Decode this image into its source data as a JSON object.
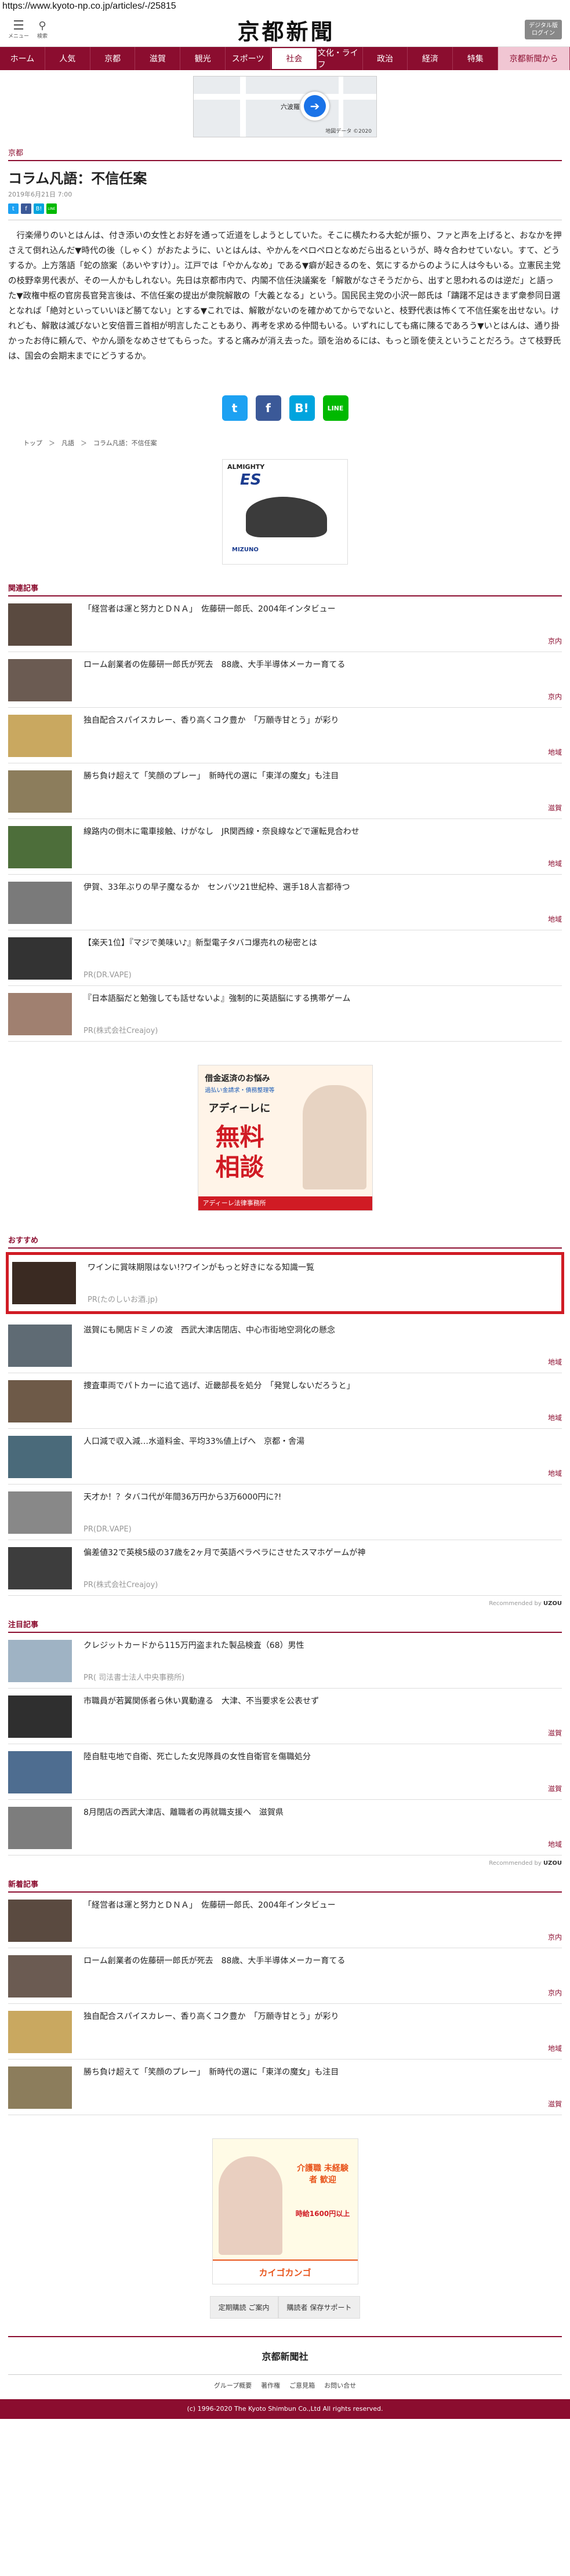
{
  "url": "https://www.kyoto-np.co.jp/articles/-/25815",
  "header": {
    "menu_label": "メニュー",
    "search_label": "検索",
    "logo": "京都新聞",
    "account_label": "デジタル版",
    "account_sub": "ログイン"
  },
  "nav": [
    {
      "label": "ホーム"
    },
    {
      "label": "人気"
    },
    {
      "label": "京都"
    },
    {
      "label": "滋賀"
    },
    {
      "label": "観光"
    },
    {
      "label": "スポーツ"
    },
    {
      "label": "社会"
    },
    {
      "label": "文化・ライフ"
    },
    {
      "label": "政治"
    },
    {
      "label": "経済"
    },
    {
      "label": "特集"
    },
    {
      "label": "京都新聞から"
    }
  ],
  "map_ad": {
    "label": "六波羅",
    "credit": "地図データ ©2020"
  },
  "article": {
    "category": "京都",
    "title": "コラム凡語：不信任案",
    "date": "2019年6月21日 7:00",
    "body": "行楽帰りのいとはんは、付き添いの女性とお好を通って近道をしようとしていた。そこに横たわる大蛇が振り、ファと声を上げると、おなかを押さえて倒れ込んだ▼時代の後（しゃく）がおたように、いとはんは、やかんをペロペロとなめだら出るというが、時々合わせていない。すて、どうするか。上方落語「蛇の旅案（あいやすけ）」。江戸では「やかんなめ」である▼癖が起きるのを、気にするからのように人は今もいる。立憲民主党の枝野幸男代表が、その一人かもしれない。先日は京都市内で、内閣不信任決議案を「解散がなさそうだから、出すと思われるのは逆だ」と語った▼政権中枢の官房長官発言後は、不信任案の提出が衆院解散の「大義となる」という。国民民主党の小沢一郎氏は「躊躇不足はきまず衆参同日選となれば「絶対といっていいほど勝てない」とする▼これでは、解散がないのを確かめてからでないと、枝野代表は怖くて不信任案を出せない。けれども、解散は滅びないと安倍晋三首相が明言したこともあり、再考を求める仲間もいる。いずれにしても痛に陳るであろう▼いとはんは、通り掛かったお侍に頼んで、やかん頭をなめさせてもらった。すると痛みが消え去った。頭を治めるには、もっと頭を使えということだろう。さて枝野氏は、国会の会期末までにどうするか。",
    "breadcrumb": "トップ　＞　凡語　＞　コラム凡語：不信任案"
  },
  "share": {
    "twitter": "t",
    "facebook": "f",
    "hatena": "B!",
    "line": "LINE"
  },
  "shoe_ad": {
    "top": "ALMIGHTY",
    "big": "ES",
    "brand": "MIZUNO"
  },
  "related": {
    "heading": "関連記事",
    "items": [
      {
        "title": "「経営者は運と努力とＤＮＡ」　佐藤研一郎氏、2004年インタビュー",
        "cat": "京内"
      },
      {
        "title": "ローム創業者の佐藤研一郎氏が死去　88歳、大手半導体メーカー育てる",
        "cat": "京内"
      },
      {
        "title": "独自配合スパイスカレー、香り高くコク豊か　「万願寺甘とう」が彩り",
        "cat": "地域"
      },
      {
        "title": "勝ち負け超えて「笑顔のプレー」　新時代の選に「東洋の魔女」も注目",
        "cat": "滋賀"
      },
      {
        "title": "線路内の倒木に電車接触、けがなし　JR関西線・奈良線などで運転見合わせ",
        "cat": "地域"
      },
      {
        "title": "伊賀、33年ぶりの早子魔なるか　センバツ21世紀枠、選手18人言都待つ",
        "cat": "地域"
      },
      {
        "title": "【楽天1位】『マジで美味い♪』新型電子タバコ爆売れの秘密とは",
        "pr": "PR(DR.VAPE)"
      },
      {
        "title": "『日本語脳だと勉強しても話せないよ』強制的に英語脳にする携帯ゲーム",
        "pr": "PR(株式会社Creajoy)"
      }
    ]
  },
  "lawyer_ad": {
    "line1": "借金返済のお悩み",
    "line2": "過払い金請求・債務整理等",
    "line3": "アディーレに",
    "line4": "無料 相談",
    "foot": "アディーレ法律事務所"
  },
  "recommend": {
    "heading": "おすすめ",
    "items": [
      {
        "title": "ワインに賞味期限はない!?ワインがもっと好きになる知識一覧",
        "pr": "PR(たのしいお酒.jp)"
      },
      {
        "title": "滋賀にも開店ドミノの波　西武大津店閉店、中心市街地空洞化の懸念",
        "cat": "地域"
      },
      {
        "title": "捜査車両でパトカーに追て逃げ、近畿部長を処分　「発覚しないだろうと」",
        "cat": "地域"
      },
      {
        "title": "人口減で収入減…水道料金、平均33%値上げへ　京都・舎湯",
        "cat": "地域"
      },
      {
        "title": "天才か！？タバコ代が年間36万円から3万6000円に?!",
        "pr": "PR(DR.VAPE)"
      },
      {
        "title": "偏差値32で英検5級の37歳を2ヶ月で英語ペラペラにさせたスマホゲームが神",
        "pr": "PR(株式会社Creajoy)"
      }
    ],
    "powered": "Recommended by",
    "powered_brand": "UZOU"
  },
  "notable": {
    "heading": "注目記事",
    "items": [
      {
        "title": "クレジットカードから115万円盗まれた製品検査（68）男性",
        "pr": "PR( 司法書士法人中央事務所)"
      },
      {
        "title": "市職員が若翼関係者ら休い異動違る　大津、不当要求を公表せず",
        "cat": "滋賀"
      },
      {
        "title": "陸自駐屯地で自衛、死亡した女児隊員の女性自衛官を傷職処分",
        "cat": "滋賀"
      },
      {
        "title": "8月閉店の西武大津店、離職者の再就職支援へ　滋賀県",
        "cat": "地域"
      }
    ],
    "powered": "Recommended by",
    "powered_brand": "UZOU"
  },
  "newest": {
    "heading": "新着記事",
    "items": [
      {
        "title": "「経営者は運と努力とＤＮＡ」　佐藤研一郎氏、2004年インタビュー",
        "cat": "京内"
      },
      {
        "title": "ローム創業者の佐藤研一郎氏が死去　88歳、大手半導体メーカー育てる",
        "cat": "京内"
      },
      {
        "title": "独自配合スパイスカレー、香り高くコク豊か　「万願寺甘とう」が彩り",
        "cat": "地域"
      },
      {
        "title": "勝ち負け超えて「笑顔のプレー」　新時代の選に「東洋の魔女」も注目",
        "cat": "滋賀"
      }
    ]
  },
  "kaigo_ad": {
    "t1": "介護職 未経験者 歓迎",
    "t2": "時給1600円以上",
    "bottom": "カイゴカンゴ"
  },
  "footer": {
    "link1": "定期購読 ご案内",
    "link2": "購読者 保存サポート",
    "logo": "京都新聞社",
    "nav": [
      "グループ概要",
      "著作権",
      "ご意見箱",
      "お問い合せ"
    ],
    "copyright": "(c) 1996-2020 The Kyoto Shimbun Co.,Ltd All rights reserved."
  }
}
